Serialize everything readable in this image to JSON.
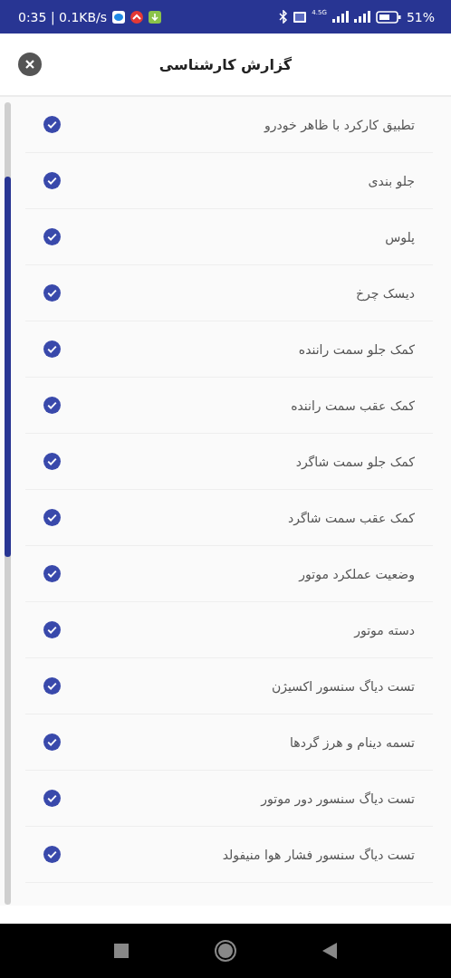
{
  "status_bar": {
    "time": "0:35 | 0.1KB/s",
    "network_type": "4.5G",
    "battery": "51%"
  },
  "header": {
    "title": "گزارش کارشناسی"
  },
  "checklist": [
    {
      "label": "تطبیق کارکرد با ظاهر خودرو",
      "checked": true
    },
    {
      "label": "جلو بندی",
      "checked": true
    },
    {
      "label": "پلوس",
      "checked": true
    },
    {
      "label": "دیسک چرخ",
      "checked": true
    },
    {
      "label": "کمک جلو سمت راننده",
      "checked": true
    },
    {
      "label": "کمک عقب سمت راننده",
      "checked": true
    },
    {
      "label": "کمک جلو سمت شاگرد",
      "checked": true
    },
    {
      "label": "کمک عقب سمت شاگرد",
      "checked": true
    },
    {
      "label": "وضعیت عملکرد موتور",
      "checked": true
    },
    {
      "label": "دسته موتور",
      "checked": true
    },
    {
      "label": "تست دیاگ سنسور اکسیژن",
      "checked": true
    },
    {
      "label": "تسمه دینام و هرز گردها",
      "checked": true
    },
    {
      "label": "تست دیاگ سنسور دور موتور",
      "checked": true
    },
    {
      "label": "تست دیاگ سنسور فشار هوا منیفولد",
      "checked": true
    }
  ]
}
